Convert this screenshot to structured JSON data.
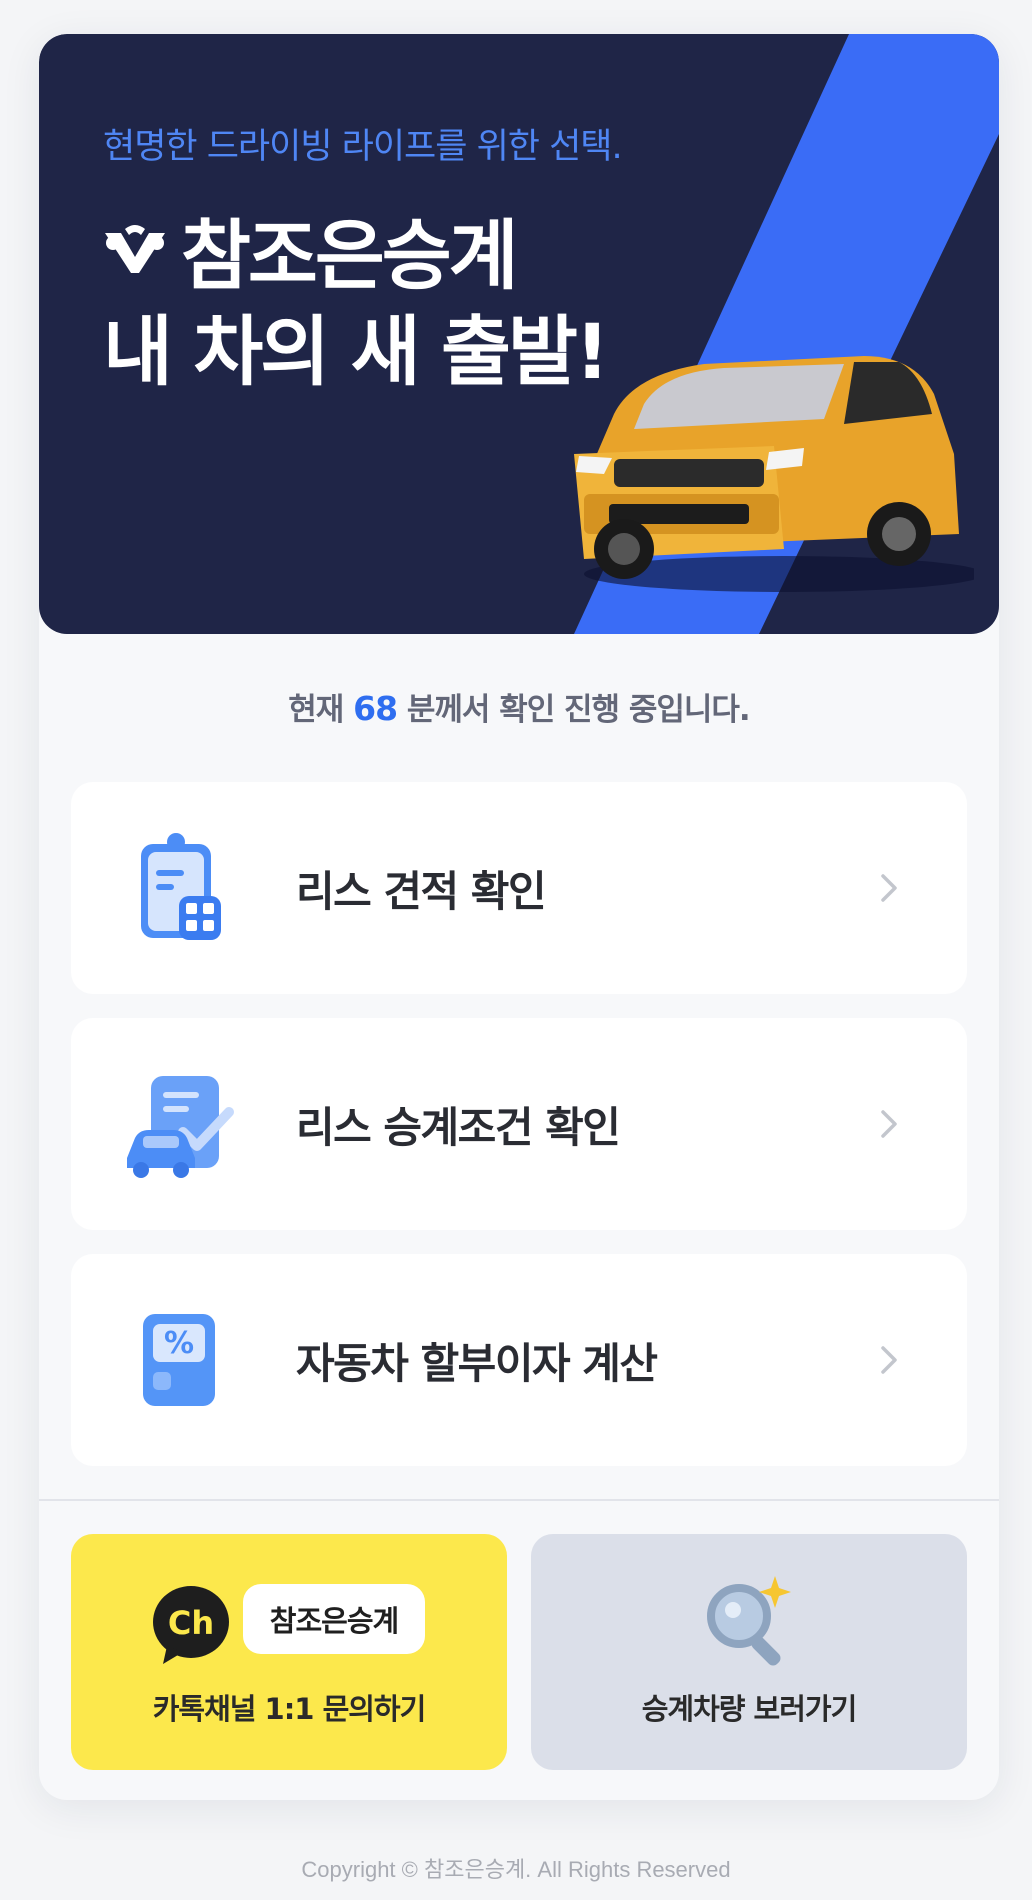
{
  "hero": {
    "tagline": "현명한 드라이빙 라이프를 위한 선택.",
    "brand": "참조은승계",
    "headline": "내 차의 새 출발!"
  },
  "counter": {
    "prefix": "현재 ",
    "count": "68",
    "suffix": " 분께서 확인 진행 중입니다."
  },
  "menu": {
    "items": [
      {
        "label": "리스 견적 확인",
        "icon": "clipboard-calculator-icon"
      },
      {
        "label": "리스 승계조건 확인",
        "icon": "car-document-check-icon"
      },
      {
        "label": "자동차 할부이자 계산",
        "icon": "percent-calculator-icon"
      }
    ]
  },
  "actions": {
    "kakao": {
      "channel_name": "참조은승계",
      "badge": "Ch",
      "caption": "카톡채널 1:1 문의하기"
    },
    "view": {
      "caption": "승계차량 보러가기",
      "icon": "magnifier-sparkle-icon"
    }
  },
  "footer": {
    "text": "Copyright © 참조은승계. All Rights Reserved"
  },
  "colors": {
    "hero_bg": "#1f2547",
    "accent": "#2f6ef0",
    "stripe": "#3a6cf6",
    "kakao": "#fce84c",
    "view_bg": "#dbdfe9"
  }
}
